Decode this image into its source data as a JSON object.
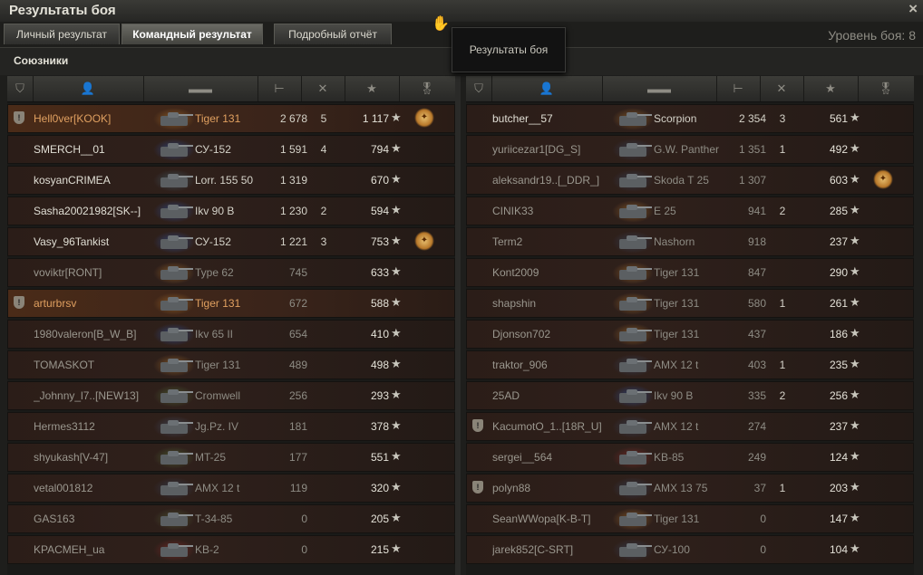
{
  "window": {
    "title": "Результаты боя",
    "close_icon": "×"
  },
  "tabs": [
    {
      "label": "Личный результат",
      "active": false
    },
    {
      "label": "Командный результат",
      "active": true
    },
    {
      "label": "Подробный отчёт",
      "active": false
    }
  ],
  "battle_level": "Уровень боя: 8",
  "tooltip": "Результаты боя",
  "allies_label": "Союзники",
  "columns": {
    "icons": [
      "tank-icon",
      "player-icon",
      "vehicle-icon",
      "xp-icon",
      "kills-icon",
      "score-star-icon",
      "medal-icon"
    ]
  },
  "left_team": [
    {
      "name": "Hell0ver[KOOK]",
      "vehicle": "Tiger 131",
      "xp": "2 678",
      "kills": "5",
      "score": "1 117",
      "dead": false,
      "highlight": true,
      "badge": true,
      "medal": true,
      "nation": "#c08030"
    },
    {
      "name": "SMERCH__01",
      "vehicle": "СУ-152",
      "xp": "1 591",
      "kills": "4",
      "score": "794",
      "dead": false,
      "highlight": false,
      "badge": false,
      "medal": false,
      "nation": "#3060c0"
    },
    {
      "name": "kosyanCRIMEA",
      "vehicle": "Lorr. 155 50",
      "xp": "1 319",
      "kills": "",
      "score": "670",
      "dead": false,
      "highlight": false,
      "badge": false,
      "medal": false,
      "nation": "#4a7080"
    },
    {
      "name": "Sasha20021982[SK--]",
      "vehicle": "Ikv 90 B",
      "xp": "1 230",
      "kills": "2",
      "score": "594",
      "dead": false,
      "highlight": false,
      "badge": false,
      "medal": false,
      "nation": "#3060c0"
    },
    {
      "name": "Vasy_96Tankist",
      "vehicle": "СУ-152",
      "xp": "1 221",
      "kills": "3",
      "score": "753",
      "dead": false,
      "highlight": false,
      "badge": false,
      "medal": true,
      "nation": "#3060c0"
    },
    {
      "name": "voviktr[RONT]",
      "vehicle": "Type 62",
      "xp": "745",
      "kills": "",
      "score": "633",
      "dead": true,
      "highlight": false,
      "badge": false,
      "medal": false,
      "nation": "#c08030"
    },
    {
      "name": "arturbrsv",
      "vehicle": "Tiger 131",
      "xp": "672",
      "kills": "",
      "score": "588",
      "dead": true,
      "highlight": true,
      "badge": true,
      "medal": false,
      "nation": "#c08030"
    },
    {
      "name": "1980valeron[B_W_B]",
      "vehicle": "Ikv 65 II",
      "xp": "654",
      "kills": "",
      "score": "410",
      "dead": true,
      "highlight": false,
      "badge": false,
      "medal": false,
      "nation": "#3060c0"
    },
    {
      "name": "TOMASKOT",
      "vehicle": "Tiger 131",
      "xp": "489",
      "kills": "",
      "score": "498",
      "dead": true,
      "highlight": false,
      "badge": false,
      "medal": false,
      "nation": "#c08030"
    },
    {
      "name": "_Johnny_l7..[NEW13]",
      "vehicle": "Cromwell",
      "xp": "256",
      "kills": "",
      "score": "293",
      "dead": true,
      "highlight": false,
      "badge": false,
      "medal": false,
      "nation": "#5a8040"
    },
    {
      "name": "Hermes3112",
      "vehicle": "Jg.Pz. IV",
      "xp": "181",
      "kills": "",
      "score": "378",
      "dead": true,
      "highlight": false,
      "badge": false,
      "medal": false,
      "nation": "#4a6080"
    },
    {
      "name": "shyukash[V-47]",
      "vehicle": "MT-25",
      "xp": "177",
      "kills": "",
      "score": "551",
      "dead": true,
      "highlight": false,
      "badge": false,
      "medal": false,
      "nation": "#5a8040"
    },
    {
      "name": "vetal001812",
      "vehicle": "AMX 12 t",
      "xp": "119",
      "kills": "",
      "score": "320",
      "dead": true,
      "highlight": false,
      "badge": false,
      "medal": false,
      "nation": "#3a5070"
    },
    {
      "name": "GAS163",
      "vehicle": "T-34-85",
      "xp": "0",
      "kills": "",
      "score": "205",
      "dead": true,
      "highlight": false,
      "badge": false,
      "medal": false,
      "nation": "#5a7040"
    },
    {
      "name": "KPACMEH_ua",
      "vehicle": "KB-2",
      "xp": "0",
      "kills": "",
      "score": "215",
      "dead": true,
      "highlight": false,
      "badge": false,
      "medal": false,
      "nation": "#a03030"
    }
  ],
  "right_team": [
    {
      "name": "butcher__57",
      "vehicle": "Scorpion",
      "xp": "2 354",
      "kills": "3",
      "score": "561",
      "dead": false,
      "highlight": false,
      "badge": false,
      "medal": false,
      "nation": "#c08030"
    },
    {
      "name": "yuriicezar1[DG_S]",
      "vehicle": "G.W. Panther",
      "xp": "1 351",
      "kills": "1",
      "score": "492",
      "dead": true,
      "highlight": false,
      "badge": false,
      "medal": false,
      "nation": "#3a5070"
    },
    {
      "name": "aleksandr19..[_DDR_]",
      "vehicle": "Skoda T 25",
      "xp": "1 307",
      "kills": "",
      "score": "603",
      "dead": true,
      "highlight": false,
      "badge": false,
      "medal": true,
      "nation": "#3a5070"
    },
    {
      "name": "CINIK33",
      "vehicle": "E 25",
      "xp": "941",
      "kills": "2",
      "score": "285",
      "dead": true,
      "highlight": false,
      "badge": false,
      "medal": false,
      "nation": "#c08030"
    },
    {
      "name": "Term2",
      "vehicle": "Nashorn",
      "xp": "918",
      "kills": "",
      "score": "237",
      "dead": true,
      "highlight": false,
      "badge": false,
      "medal": false,
      "nation": "#3a5070"
    },
    {
      "name": "Kont2009",
      "vehicle": "Tiger 131",
      "xp": "847",
      "kills": "",
      "score": "290",
      "dead": true,
      "highlight": false,
      "badge": false,
      "medal": false,
      "nation": "#c08030"
    },
    {
      "name": "shapshin",
      "vehicle": "Tiger 131",
      "xp": "580",
      "kills": "1",
      "score": "261",
      "dead": true,
      "highlight": false,
      "badge": false,
      "medal": false,
      "nation": "#c08030"
    },
    {
      "name": "Djonson702",
      "vehicle": "Tiger 131",
      "xp": "437",
      "kills": "",
      "score": "186",
      "dead": true,
      "highlight": false,
      "badge": false,
      "medal": false,
      "nation": "#c08030"
    },
    {
      "name": "traktor_906",
      "vehicle": "AMX 12 t",
      "xp": "403",
      "kills": "1",
      "score": "235",
      "dead": true,
      "highlight": false,
      "badge": false,
      "medal": false,
      "nation": "#3a5070"
    },
    {
      "name": "25AD",
      "vehicle": "Ikv 90 B",
      "xp": "335",
      "kills": "2",
      "score": "256",
      "dead": true,
      "highlight": false,
      "badge": false,
      "medal": false,
      "nation": "#3060c0"
    },
    {
      "name": "KacumotO_1..[18R_U]",
      "vehicle": "AMX 12 t",
      "xp": "274",
      "kills": "",
      "score": "237",
      "dead": true,
      "highlight": false,
      "badge": true,
      "medal": false,
      "nation": "#3a5070"
    },
    {
      "name": "sergei__564",
      "vehicle": "KB-85",
      "xp": "249",
      "kills": "",
      "score": "124",
      "dead": true,
      "highlight": false,
      "badge": false,
      "medal": false,
      "nation": "#a03030"
    },
    {
      "name": "polyn88",
      "vehicle": "AMX 13 75",
      "xp": "37",
      "kills": "1",
      "score": "203",
      "dead": true,
      "highlight": false,
      "badge": true,
      "medal": false,
      "nation": "#3a5070"
    },
    {
      "name": "SeanWWopa[K-B-T]",
      "vehicle": "Tiger 131",
      "xp": "0",
      "kills": "",
      "score": "147",
      "dead": true,
      "highlight": false,
      "badge": false,
      "medal": false,
      "nation": "#c08030"
    },
    {
      "name": "jarek852[C-SRT]",
      "vehicle": "СУ-100",
      "xp": "0",
      "kills": "",
      "score": "104",
      "dead": true,
      "highlight": false,
      "badge": false,
      "medal": false,
      "nation": "#3a5070"
    }
  ]
}
